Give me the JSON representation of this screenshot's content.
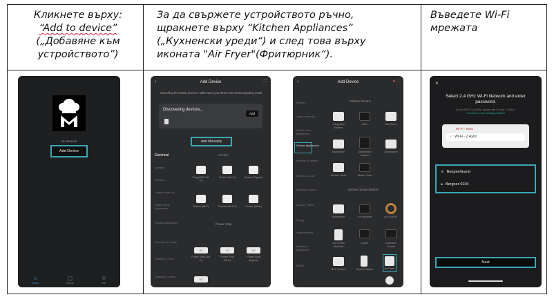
{
  "steps": [
    {
      "instruction_lines": [
        "Кликнете върху:",
        "“Add to device”",
        "(„Добавяне към",
        "устройството”)"
      ]
    },
    {
      "instruction_lines": [
        "За да свържете устройството ръчно,",
        "щракнете върху “Kitchen Appliances”",
        "(„Кухненски уреди“) и след това върху",
        "иконата \"Air Fryer\"(Фритюрник“)."
      ]
    },
    {
      "instruction_lines": [
        "Въведете Wi-Fi",
        "мрежата"
      ]
    }
  ],
  "phone1": {
    "no_devices": "No devices",
    "add_device_button": "Add Device",
    "tabs": [
      {
        "icon": "home-icon",
        "label": "Home",
        "active": true
      },
      {
        "icon": "scene-icon",
        "label": "Scene",
        "active": false
      },
      {
        "icon": "me-icon",
        "label": "Me",
        "active": false
      }
    ]
  },
  "phone2": {
    "title": "Add Device",
    "search_note": "Searching for nearby devices. Make sure your device has entered pairing mode.",
    "discovering": "Discovering devices...",
    "add": "Add",
    "add_manually": "Add Manually",
    "categories": [
      "Electrical",
      "Socket"
    ],
    "side_items": [
      "Lighting",
      "Sensors",
      "Large Home Ap...",
      "Small Home Appliances",
      "Kitchen Appliances",
      "Exercise & Health",
      "Camera & Lock",
      "Gateway Control"
    ],
    "devices_row1": [
      "Plug (BLE+Wi-Fi)",
      "Socket (Wi-Fi)",
      "Socket (Zigbee)"
    ],
    "devices_row2": [
      "Socket (BLE)",
      "Socket (NB-IoT)",
      "Socket (other)"
    ],
    "power_strip_header": "Power Strip",
    "strip_label": "V2",
    "strips": [
      "Power Strip (Wi-Fi)",
      "Power Strip (BLE)",
      "Power Strip (Zigbee)"
    ]
  },
  "phone3": {
    "title": "Add Device",
    "section_kitchen": "Kitchen Electric",
    "section_smart": "Kitchen Smart Electric",
    "side_items": [
      "Sensors",
      "Large Home Ap...",
      "Small Home Appliances",
      "Kitchen Appliances",
      "Exercise & Health",
      "Camera & Lock",
      "Gateway Control",
      "Outdoor Travel",
      "Energy",
      "Entertainment",
      "Industry & Agriculture",
      "Others"
    ],
    "row1": [
      "Integrated Kitchen",
      "Oven",
      "Gas Stove"
    ],
    "row2": [
      "Microwave",
      "Disinfection Cabinet",
      "Dishwasher"
    ],
    "row3": [
      "Kitchen Hood",
      "Steam Oven"
    ],
    "row4": [
      "Dehydrator",
      "Ice Machine",
      "Air Cook M."
    ],
    "row5": [
      "Ice Cream Machine",
      "Cooler",
      "Induction Cooker"
    ],
    "row6": [
      "Rice Cooker",
      "Soymilk Maker",
      "Air Fryer"
    ]
  },
  "phone4": {
    "title": "Select 2.4 GHz Wi-Fi Network and enter password.",
    "note": "If your Wi-Fi is 5GHz, please set it to be 2.4GHz.",
    "note_link": "Common router setting method",
    "band5": "Wi-Fi - 5Ghz",
    "band24": "Wi-Fi - 2.4Ghz",
    "networks": [
      "BergnerGuest",
      "Bergner-0104"
    ],
    "next": "Next"
  }
}
